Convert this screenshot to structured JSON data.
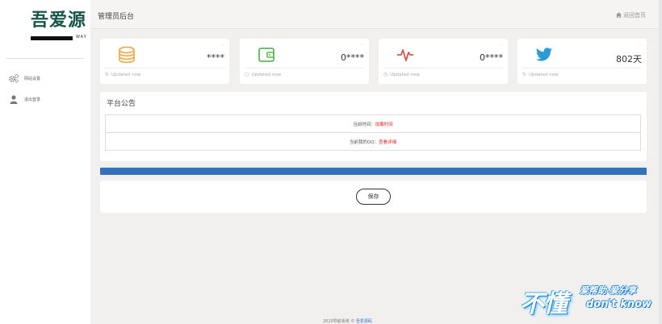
{
  "sidebar": {
    "logo_text": "吾爱源",
    "logo_sub": "WAY",
    "items": [
      {
        "label": "网站设置",
        "icon": "gears-icon"
      },
      {
        "label": "退出登录",
        "icon": "user-icon"
      }
    ]
  },
  "header": {
    "title": "管理员后台",
    "home_label": "返回首页",
    "home_icon": "home-icon"
  },
  "stats": [
    {
      "icon": "coins-icon",
      "small": "...",
      "value": "****",
      "updated": "Updated now",
      "foot_icon": "refresh-icon",
      "color": "#f0ad4e"
    },
    {
      "icon": "wallet-icon",
      "small": "...",
      "value": "0****",
      "updated": "Updated now",
      "foot_icon": "calendar-icon",
      "color": "#5cb85c"
    },
    {
      "icon": "pulse-icon",
      "small": "...",
      "value": "0****",
      "updated": "Updated now",
      "foot_icon": "clock-icon",
      "color": "#d9534f"
    },
    {
      "icon": "twitter-icon",
      "small": "...",
      "value": "802天",
      "updated": "Updated now",
      "foot_icon": "refresh-icon",
      "color": "#2b9bd3"
    }
  ],
  "notice": {
    "title": "平台公告",
    "rows": [
      {
        "label": "当前时间：",
        "value": "加载时间"
      },
      {
        "label": "当前我的QQ：",
        "value": "查看详细"
      }
    ]
  },
  "progress": {
    "percent": 100,
    "color": "#3372b8"
  },
  "save_label": "保存",
  "footer": {
    "prefix": "2020导航系统 © ",
    "link": "吾爱源码"
  },
  "watermark": {
    "big": "不懂",
    "top": "爱帮助·爱分享",
    "bottom": "don't know"
  }
}
